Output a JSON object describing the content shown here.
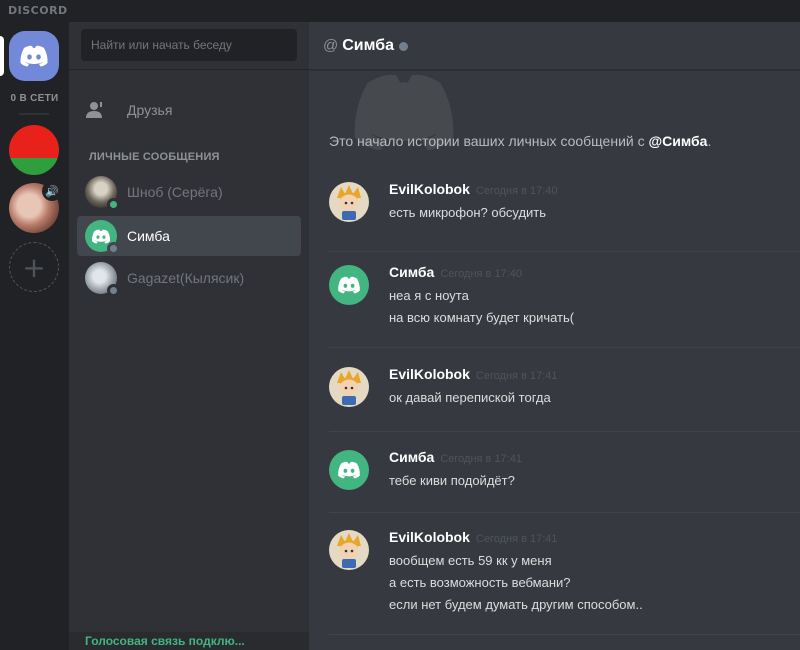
{
  "app": {
    "wordmark": "DISCORD"
  },
  "servers": {
    "online_count": "0 В СЕТИ"
  },
  "sidebar": {
    "search_placeholder": "Найти или начать беседу",
    "friends_label": "Друзья",
    "dm_header": "ЛИЧНЫЕ СООБЩЕНИЯ",
    "dms": [
      {
        "name": "Шноб (Серёга)",
        "status": "online"
      },
      {
        "name": "Симба",
        "status": "offline"
      },
      {
        "name": "Gagazet(Кылясик)",
        "status": "offline"
      }
    ],
    "voice_status": "Голосовая связь подклю..."
  },
  "chat": {
    "at": "@",
    "channel_name": "Симба",
    "intro_prefix": "Это начало истории ваших личных сообщений с ",
    "intro_name": "@Симба",
    "intro_suffix": ".",
    "groups": [
      {
        "author": "EvilKolobok",
        "time": "Сегодня в 17:40",
        "lines": [
          "есть микрофон? обсудить"
        ]
      },
      {
        "author": "Симба",
        "time": "Сегодня в 17:40",
        "lines": [
          "неа я с ноута",
          "на всю комнату будет кричать("
        ]
      },
      {
        "author": "EvilKolobok",
        "time": "Сегодня в 17:41",
        "lines": [
          "ок давай перепиской тогда"
        ]
      },
      {
        "author": "Симба",
        "time": "Сегодня в 17:41",
        "lines": [
          "тебе киви подойдёт?"
        ]
      },
      {
        "author": "EvilKolobok",
        "time": "Сегодня в 17:41",
        "lines": [
          "вообщем есть 59 кк у меня",
          "а есть возможность вебмани?",
          "если нет будем думать другим способом.."
        ]
      }
    ]
  },
  "colors": {
    "blurple": "#7289da",
    "green": "#43b581",
    "chat_bg": "#36393f",
    "sidebar_bg": "#2f3136",
    "server_bg": "#202225"
  }
}
